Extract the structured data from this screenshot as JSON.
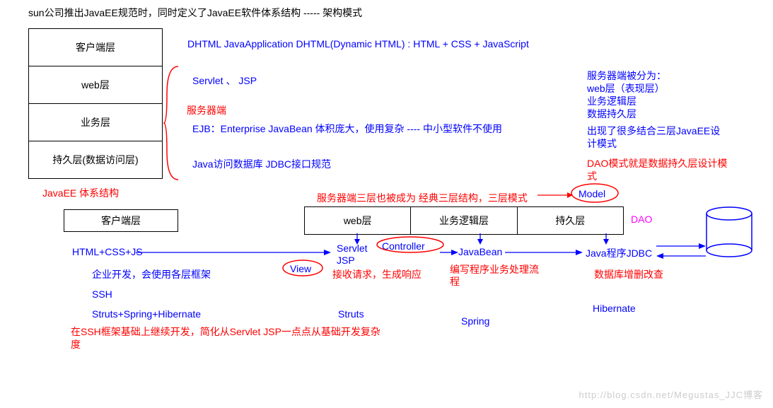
{
  "header": {
    "title": "sun公司推出JavaEE规范时，同时定义了JavaEE软件体系结构    -----  架构模式"
  },
  "leftStack": {
    "rows": [
      "客户端层",
      "web层",
      "业务层",
      "持久层(数据访问层)"
    ],
    "caption": "JavaEE 体系结构"
  },
  "rowTexts": {
    "row1": "DHTML    JavaApplication   DHTML(Dynamic HTML) : HTML + CSS + JavaScript",
    "row2": "Servlet 、 JSP",
    "serverSide": "服务器端",
    "row3": "EJB：Enterprise JavaBean 体积庞大，使用复杂 ---- 中小型软件不使用",
    "row4": "Java访问数据库 JDBC接口规范"
  },
  "rightNotes": {
    "l1": "服务器端被分为：",
    "l2": "web层（表现层）",
    "l3": "业务逻辑层",
    "l4": "数据持久层",
    "l5": "出现了很多结合三层JavaEE设计模式",
    "dao": "DAO模式就是数据持久层设计模式"
  },
  "midRed": "服务器端三层也被成为 经典三层结构，三层模式",
  "model": "Model",
  "serverStack": {
    "c1": "web层",
    "c2": "业务逻辑层",
    "c3": "持久层",
    "dao": "DAO"
  },
  "clientBox": "客户端层",
  "flow": {
    "client": "HTML+CSS+JS",
    "servlet": "Servlet",
    "jsp": "JSP",
    "controller": "Controller",
    "view": "View",
    "recv": "接收请求，生成响应",
    "javabean": "JavaBean",
    "bizFlow": "编写程序业务处理流程",
    "jdbc": "Java程序JDBC",
    "crud": "数据库增删改查"
  },
  "bottom": {
    "useFrameworks": "企业开发，会使用各层框架",
    "ssh": "SSH",
    "sshExpand": "Struts+Spring+Hibernate",
    "struts": "Struts",
    "spring": "Spring",
    "hibernate": "Hibernate",
    "sshNote": "在SSH框架基础上继续开发，简化从Servlet JSP一点点从基础开发复杂度"
  },
  "watermark": "http://blog.csdn.net/Megustas_JJC博客"
}
